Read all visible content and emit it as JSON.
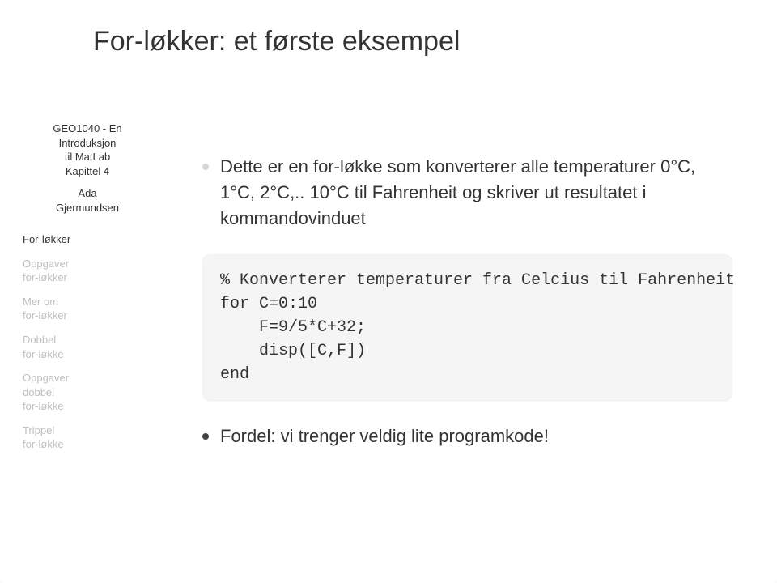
{
  "title": "For-løkker: et første eksempel",
  "sidebar": {
    "meta": [
      "GEO1040 - En",
      "Introduksjon",
      "til MatLab",
      "Kapittel 4",
      "",
      "Ada",
      "Gjermundsen"
    ],
    "nav": [
      {
        "label": "For-løkker",
        "current": true
      },
      {
        "label": "Oppgaver\nfor-løkker",
        "current": false
      },
      {
        "label": "Mer om\nfor-løkker",
        "current": false
      },
      {
        "label": "Dobbel\nfor-løkke",
        "current": false
      },
      {
        "label": "Oppgaver\ndobbel\nfor-løkke",
        "current": false
      },
      {
        "label": "Trippel\nfor-løkke",
        "current": false
      }
    ]
  },
  "content": {
    "bullet1": "Dette er en for-løkke som konverterer alle temperaturer 0°C, 1°C, 2°C,.. 10°C til Fahrenheit og skriver ut resultatet i kommandovinduet",
    "code": "% Konverterer temperaturer fra Celcius til Fahrenheit\nfor C=0:10\n    F=9/5*C+32;\n    disp([C,F])\nend",
    "bullet2": "Fordel: vi trenger veldig lite programkode!"
  }
}
